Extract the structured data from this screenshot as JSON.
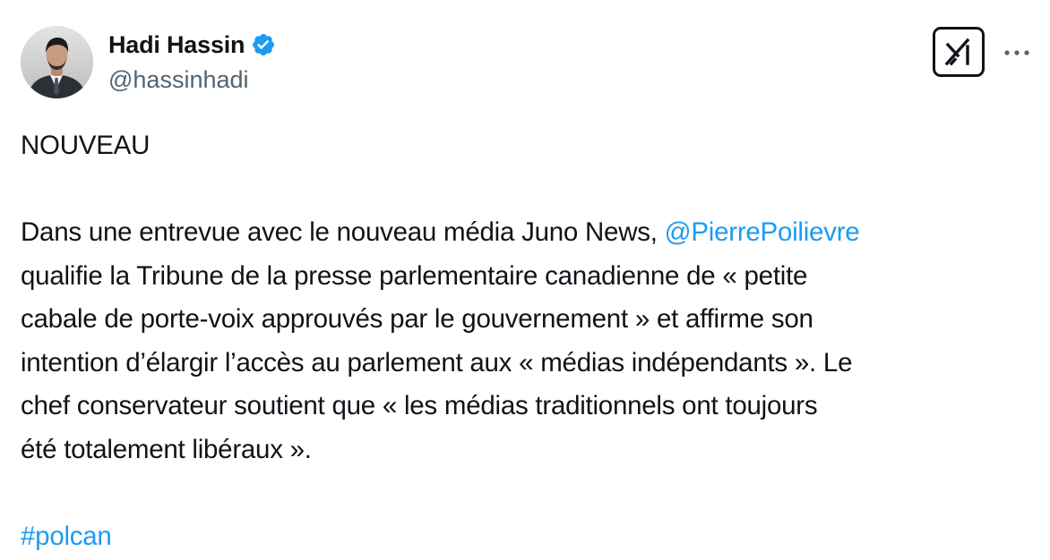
{
  "author": {
    "display_name": "Hadi Hassin",
    "handle": "@hassinhadi",
    "verified": true,
    "avatar_icon": "profile-photo"
  },
  "header_actions": {
    "grok_icon": "grok-icon",
    "more_icon": "more-options-icon"
  },
  "tweet": {
    "line_1": "NOUVEAU",
    "line_2_text": "Dans une entrevue avec le nouveau média Juno News, ",
    "line_2_mention": "@PierrePoilievre",
    "line_3": "qualifie la Tribune de la presse parlementaire canadienne de « petite",
    "line_4": "cabale de porte-voix approuvés par le gouvernement » et affirme son",
    "line_5": "intention d’élargir l’accès au parlement aux « médias indépendants ». Le",
    "line_6": "chef conservateur soutient que « les médias traditionnels ont toujours",
    "line_7": "été totalement libéraux ».",
    "hashtag": "#polcan"
  },
  "colors": {
    "text": "#0f1419",
    "secondary": "#536471",
    "accent": "#1d9bf0",
    "verified": "#1d9bf0"
  }
}
